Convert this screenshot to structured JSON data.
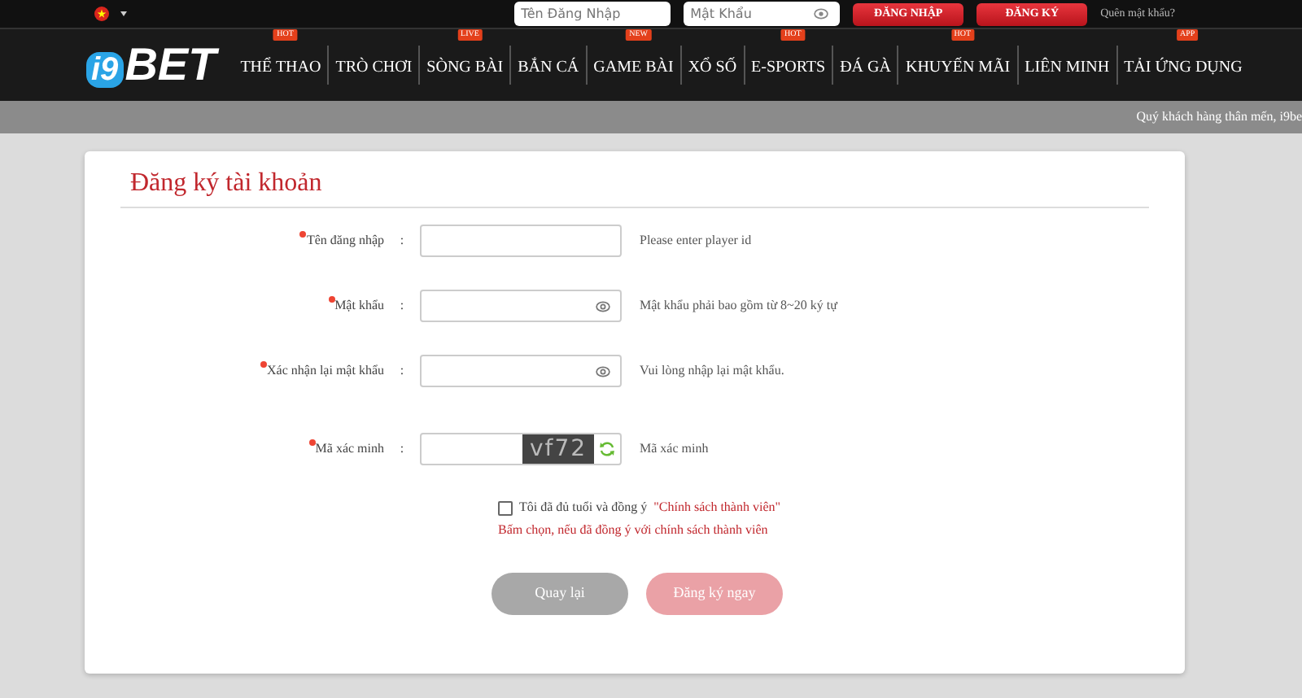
{
  "topbar": {
    "username_placeholder": "Tên Đăng Nhập",
    "password_placeholder": "Mật Khẩu",
    "login_button": "ĐĂNG NHẬP",
    "register_button": "ĐĂNG KÝ",
    "forgot_link": "Quên mật khẩu?"
  },
  "logo": {
    "prefix": "i9",
    "name": "BET"
  },
  "nav": [
    {
      "label": "THỂ THAO",
      "badge": "HOT"
    },
    {
      "label": "TRÒ CHƠI"
    },
    {
      "label": "SÒNG BÀI",
      "badge": "LIVE"
    },
    {
      "label": "BẮN CÁ"
    },
    {
      "label": "GAME BÀI",
      "badge": "NEW"
    },
    {
      "label": "XỔ SỐ"
    },
    {
      "label": "E-SPORTS",
      "badge": "HOT"
    },
    {
      "label": "ĐÁ GÀ"
    },
    {
      "label": "KHUYẾN MÃI",
      "badge": "HOT"
    },
    {
      "label": "LIÊN MINH"
    },
    {
      "label": "TẢI ỨNG DỤNG",
      "badge": "APP"
    }
  ],
  "marquee": "Quý khách hàng thân mến, i9be",
  "form": {
    "title": "Đăng ký tài khoản",
    "fields": [
      {
        "kind": "text",
        "label": "Tên đăng nhập",
        "colon": ":",
        "required": true,
        "hint": "Please enter player id"
      },
      {
        "kind": "password",
        "label": "Mật khẩu",
        "colon": ":",
        "required": true,
        "hint": "Mật khẩu phải bao gồm từ 8~20 ký tự"
      },
      {
        "kind": "password",
        "label": "Xác nhận lại mật khẩu",
        "colon": ":",
        "required": true,
        "hint": "Vui lòng nhập lại mật khẩu."
      },
      {
        "kind": "captcha",
        "label": "Mã xác minh",
        "colon": ":",
        "required": true,
        "captcha": "vf72",
        "hint": "Mã xác minh"
      }
    ],
    "agree": {
      "checked": false,
      "text": "Tôi đã đủ tuổi và đồng ý",
      "link": "\"Chính sách thành viên\"",
      "warning": "Bấm chọn, nếu đã đồng ý với chính sách thành viên"
    },
    "back_button": "Quay lại",
    "submit_button": "Đăng ký ngay"
  }
}
